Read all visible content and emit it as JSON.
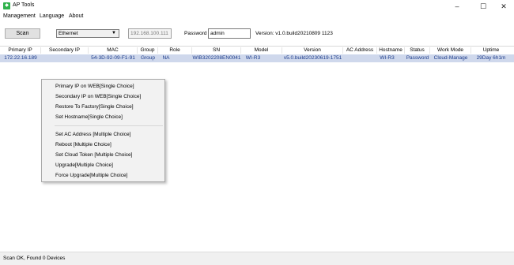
{
  "window": {
    "title": "AP Tools",
    "minimize": "–",
    "maximize": "☐",
    "close": "✕"
  },
  "menu": [
    "Management",
    "Language",
    "About"
  ],
  "toolbar": {
    "scan_label": "Scan",
    "interface": "Ethernet",
    "ip_value": "192.168.100.111",
    "password_label": "Password",
    "password_value": "admin",
    "version": "Version: v1.0.build20210809 1123"
  },
  "table": {
    "columns": [
      "Primary IP",
      "Secondary IP",
      "MAC",
      "Group",
      "Role",
      "SN",
      "Model",
      "Version",
      "AC Address",
      "Hostname",
      "Status",
      "Work Mode",
      "Uptime"
    ],
    "rows": [
      [
        "172.22.16.189",
        "",
        "54-3D-92-09-F1-91",
        "Group",
        "NA",
        "WIB3202208EN0041",
        "WI-R3",
        "v5.0.build20230619-1751",
        "",
        "WI-R3",
        "Password",
        "Cloud-Manage",
        "29Day 6h1m"
      ]
    ]
  },
  "context_menu": {
    "single": [
      "Primary IP on WEB[Single Choice]",
      "Secondary IP on WEB[Single Choice]",
      "Restore To Factory[Single Choice]",
      "Set Hostname[Single Choice]"
    ],
    "multiple": [
      "Set AC Address [Multiple Choice]",
      "Reboot [Multiple Choice]",
      "Set Cloud Token [Multiple Choice]",
      "Upgrade[Multiple Choice]",
      "Force Upgrade[Multiple Choice]"
    ]
  },
  "status": "Scan OK, Found 0 Devices"
}
